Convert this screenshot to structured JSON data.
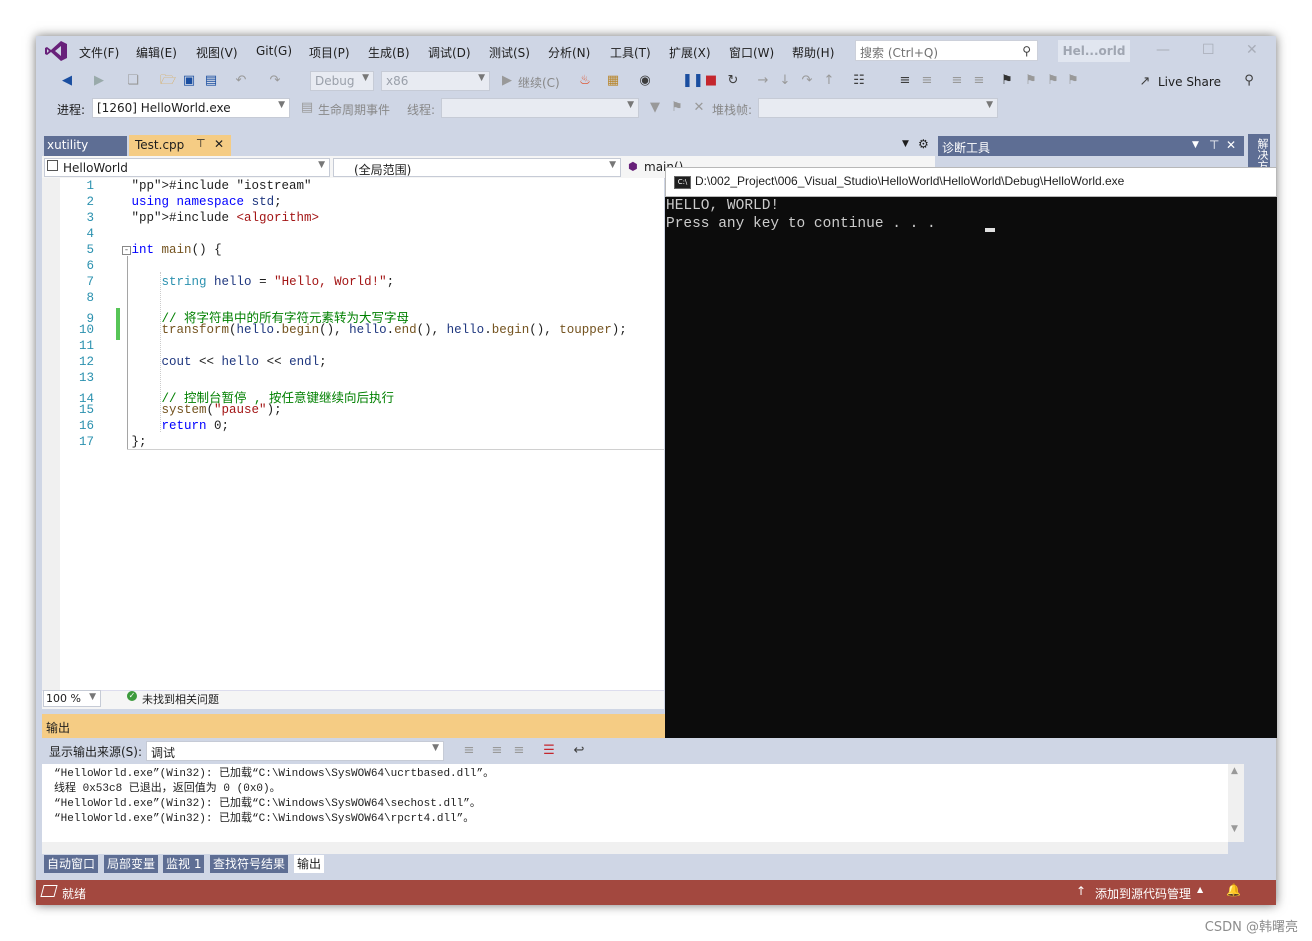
{
  "menu": [
    "文件(F)",
    "编辑(E)",
    "视图(V)",
    "Git(G)",
    "项目(P)",
    "生成(B)",
    "调试(D)",
    "测试(S)",
    "分析(N)",
    "工具(T)",
    "扩展(X)",
    "窗口(W)",
    "帮助(H)"
  ],
  "search": {
    "placeholder": "搜索 (Ctrl+Q)"
  },
  "project_badge": "Hel...orld",
  "toolbar1": {
    "config": "Debug",
    "platform": "x86",
    "continue": "继续(C)",
    "live_share": "Live Share"
  },
  "toolbar2": {
    "process_label": "进程:",
    "process_value": "[1260] HelloWorld.exe",
    "lifecycle": "生命周期事件",
    "thread_label": "线程:",
    "stackframe_label": "堆栈帧:"
  },
  "tabs": {
    "xutility": "xutility",
    "test": "Test.cpp"
  },
  "navbar": {
    "project": "HelloWorld",
    "scope": "(全局范围)",
    "member": "main()"
  },
  "code": [
    {
      "n": "1",
      "t": "#include \"iostream\""
    },
    {
      "n": "2",
      "t": "using namespace std;"
    },
    {
      "n": "3",
      "t": "#include <algorithm>"
    },
    {
      "n": "4",
      "t": ""
    },
    {
      "n": "5",
      "t": "int main() {"
    },
    {
      "n": "6",
      "t": ""
    },
    {
      "n": "7",
      "t": "string hello = \"Hello, World!\";"
    },
    {
      "n": "8",
      "t": ""
    },
    {
      "n": "9",
      "t": "// 将字符串中的所有字符元素转为大写字母"
    },
    {
      "n": "10",
      "t": "transform(hello.begin(), hello.end(), hello.begin(), toupper);"
    },
    {
      "n": "11",
      "t": ""
    },
    {
      "n": "12",
      "t": "cout << hello << endl;"
    },
    {
      "n": "13",
      "t": ""
    },
    {
      "n": "14",
      "t": "// 控制台暂停 , 按任意键继续向后执行"
    },
    {
      "n": "15",
      "t": "system(\"pause\");"
    },
    {
      "n": "16",
      "t": "return 0;"
    },
    {
      "n": "17",
      "t": "};"
    }
  ],
  "editor_status": {
    "zoom": "100 %",
    "issues": "未找到相关问题"
  },
  "diag": {
    "title": "诊断工具",
    "side_tab": "解决方"
  },
  "console": {
    "title": "D:\\002_Project\\006_Visual_Studio\\HelloWorld\\HelloWorld\\Debug\\HelloWorld.exe",
    "lines": [
      "HELLO, WORLD!",
      "Press any key to continue . . . "
    ]
  },
  "output": {
    "title": "输出",
    "source_label": "显示输出来源(S):",
    "source_value": "调试",
    "lines": [
      "“HelloWorld.exe”(Win32): 已加载“C:\\Windows\\SysWOW64\\ucrtbased.dll”。",
      "线程 0x53c8 已退出，返回值为 0 (0x0)。",
      "“HelloWorld.exe”(Win32): 已加载“C:\\Windows\\SysWOW64\\sechost.dll”。",
      "“HelloWorld.exe”(Win32): 已加载“C:\\Windows\\SysWOW64\\rpcrt4.dll”。"
    ]
  },
  "bottom_tabs": [
    "自动窗口",
    "局部变量",
    "监视 1",
    "查找符号结果",
    "输出"
  ],
  "statusbar": {
    "ready": "就绪",
    "add_source": "添加到源代码管理"
  },
  "watermark": "CSDN @韩曙亮",
  "colors": {
    "accent": "#5e6e94",
    "tab_active": "#f5cc84",
    "status": "#a3483f"
  }
}
